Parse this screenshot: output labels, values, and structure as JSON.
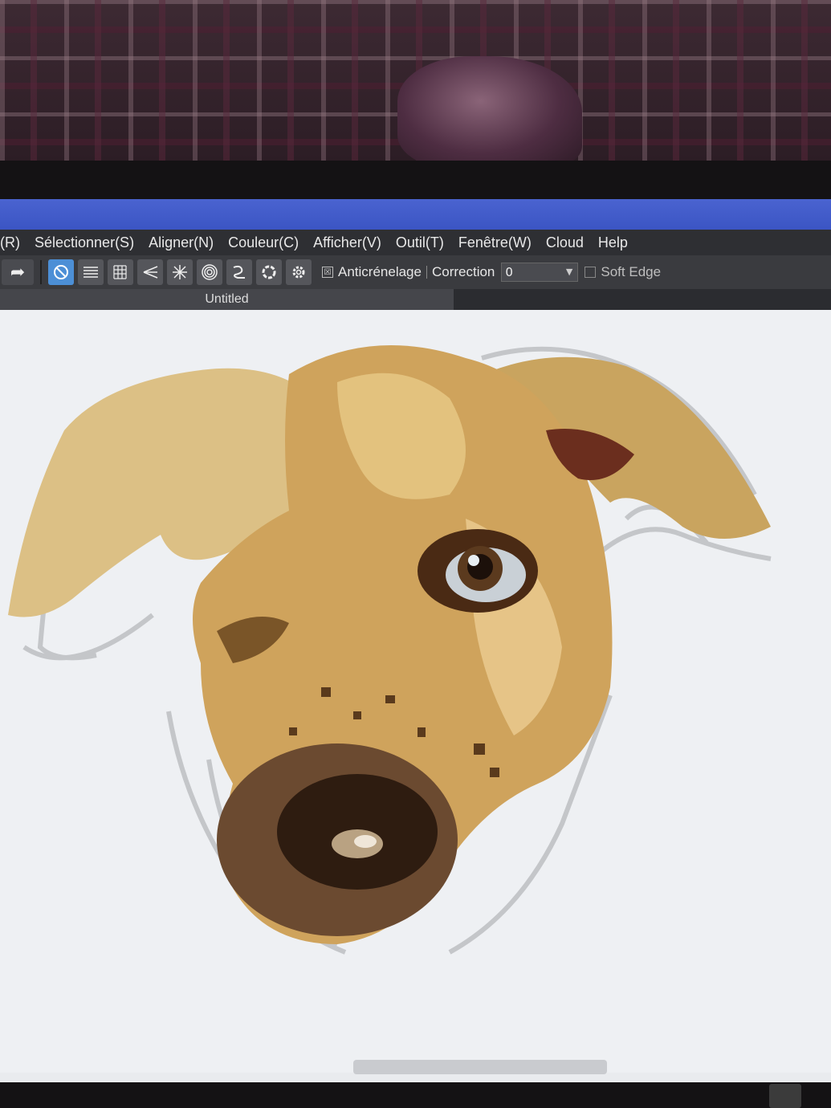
{
  "menu": {
    "items": [
      {
        "label": "(R)",
        "name": "menu-r"
      },
      {
        "label": "Sélectionner(S)",
        "name": "menu-selectionner"
      },
      {
        "label": "Aligner(N)",
        "name": "menu-aligner"
      },
      {
        "label": "Couleur(C)",
        "name": "menu-couleur"
      },
      {
        "label": "Afficher(V)",
        "name": "menu-afficher"
      },
      {
        "label": "Outil(T)",
        "name": "menu-outil"
      },
      {
        "label": "Fenêtre(W)",
        "name": "menu-fenetre"
      },
      {
        "label": "Cloud",
        "name": "menu-cloud"
      },
      {
        "label": "Help",
        "name": "menu-help"
      }
    ]
  },
  "toolbar": {
    "antialias_label": "Anticrénelage",
    "correction_label": "Correction",
    "correction_value": "0",
    "soft_edge_label": "Soft Edge"
  },
  "document": {
    "tab_title": "Untitled"
  },
  "colors": {
    "title_bar": "#4a63d0",
    "active_tool": "#4c8fd6",
    "canvas": "#eef0f3"
  }
}
